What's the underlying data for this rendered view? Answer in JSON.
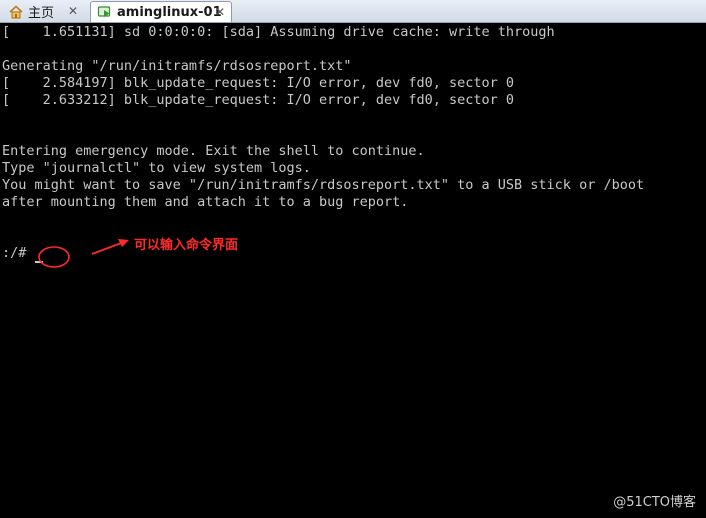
{
  "tabs": [
    {
      "label": "主页",
      "icon": "home-icon"
    },
    {
      "label": "aminglinux-01",
      "icon": "vm-icon"
    }
  ],
  "tab_close_glyph": "✕",
  "terminal_lines": [
    "[    1.651131] sd 0:0:0:0: [sda] Assuming drive cache: write through",
    "",
    "Generating \"/run/initramfs/rdsosreport.txt\"",
    "[    2.584197] blk_update_request: I/O error, dev fd0, sector 0",
    "[    2.633212] blk_update_request: I/O error, dev fd0, sector 0",
    "",
    "",
    "Entering emergency mode. Exit the shell to continue.",
    "Type \"journalctl\" to view system logs.",
    "You might want to save \"/run/initramfs/rdsosreport.txt\" to a USB stick or /boot",
    "after mounting them and attach it to a bug report.",
    "",
    "",
    ":/#"
  ],
  "annotation": "可以输入命令界面",
  "annotation_color": "#ff2a2a",
  "watermark": "@51CTO博客"
}
